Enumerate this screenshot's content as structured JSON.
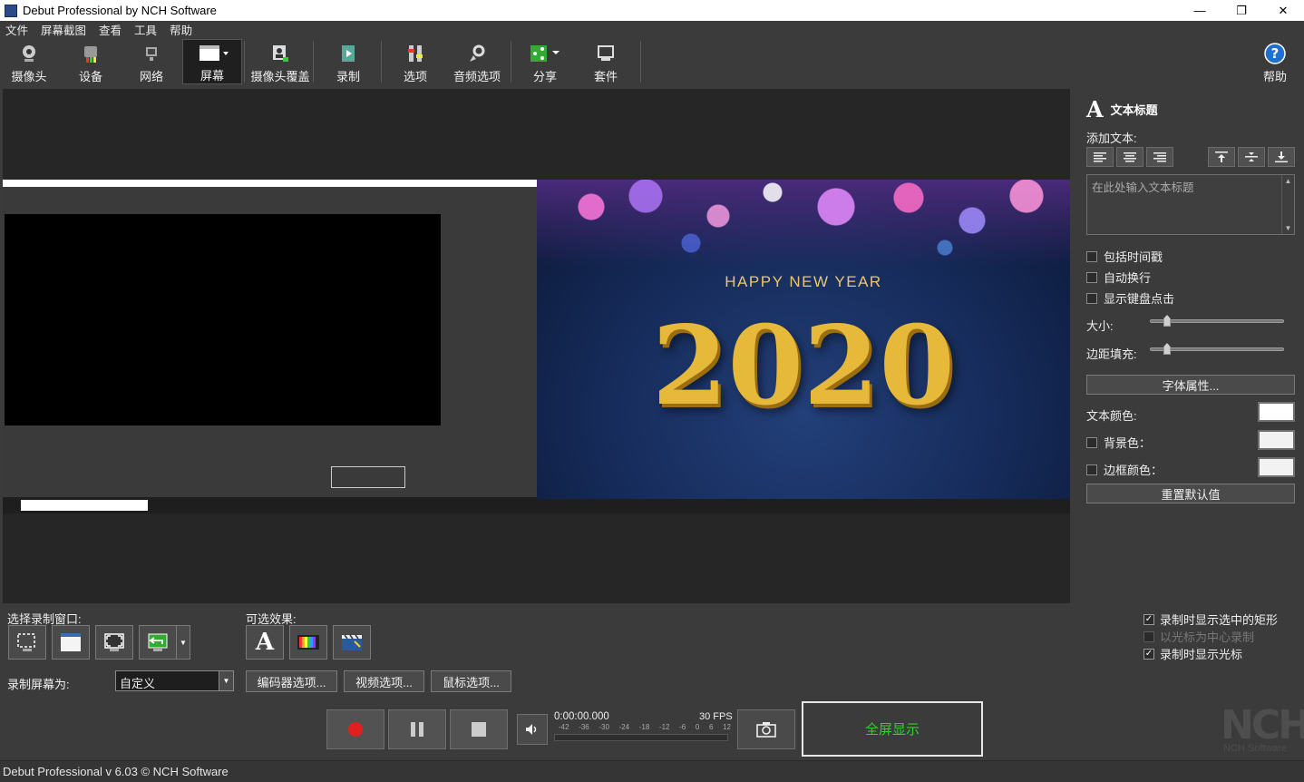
{
  "window": {
    "title": "Debut Professional by NCH Software",
    "minimize": "—",
    "maximize": "❐",
    "close": "✕"
  },
  "menu": [
    "文件",
    "屏幕截图",
    "查看",
    "工具",
    "帮助"
  ],
  "toolbar": {
    "camera": "摄像头",
    "device": "设备",
    "network": "网络",
    "screen": "屏幕",
    "webcam_overlay": "摄像头覆盖",
    "record": "录制",
    "options": "选项",
    "audio_options": "音频选项",
    "share": "分享",
    "suite": "套件",
    "help": "帮助"
  },
  "preview": {
    "greeting": "HAPPY  NEW  YEAR",
    "year": "2020"
  },
  "text_panel": {
    "title": "文本标题",
    "add_text_label": "添加文本:",
    "text_placeholder": "在此处输入文本标题",
    "include_timestamp": "包括时间戳",
    "auto_wrap": "自动换行",
    "show_keyclicks": "显示键盘点击",
    "size_label": "大小:",
    "size_value": 0.1,
    "padding_label": "边距填充:",
    "padding_value": 0.1,
    "font_props": "字体属性...",
    "text_color_label": "文本颜色:",
    "text_color": "#ffffff",
    "bg_color_label": "背景色：",
    "border_color_label": "边框颜色：",
    "reset": "重置默认值"
  },
  "bottom": {
    "select_window_label": "选择录制窗口:",
    "effects_label": "可选效果:",
    "record_as_label": "录制屏幕为:",
    "record_as_value": "自定义",
    "encoder_options": "编码器选项...",
    "video_options": "视频选项...",
    "mouse_options": "鼠标选项...",
    "show_rect": "录制时显示选中的矩形",
    "center_cursor": "以光标为中心录制",
    "show_cursor": "录制时显示光标",
    "time": "0:00:00.000",
    "fps": "30 FPS",
    "db_ticks": [
      "-42",
      "-36",
      "-30",
      "-24",
      "-18",
      "-12",
      "-6",
      "0",
      "6",
      "12"
    ],
    "fullscreen": "全屏显示"
  },
  "brand": {
    "logo": "NCH",
    "logo_sub": "NCH Software"
  },
  "status": "Debut Professional v 6.03 © NCH Software"
}
